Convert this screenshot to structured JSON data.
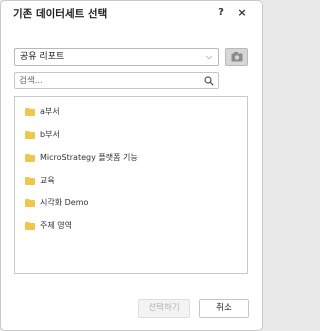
{
  "dialog": {
    "title": "기존 데이터세트 선택",
    "help_label": "?",
    "close_label": "×"
  },
  "source": {
    "selected": "공유 리포트",
    "chevron": "⌵"
  },
  "search": {
    "placeholder": "검색..."
  },
  "folders": [
    {
      "label": "a부서",
      "icon": "folder-icon"
    },
    {
      "label": "b부서",
      "icon": "folder-icon"
    },
    {
      "label": "MicroStrategy 플랫폼 기능",
      "icon": "folder-icon"
    },
    {
      "label": "교육",
      "icon": "folder-icon"
    },
    {
      "label": "시각화 Demo",
      "icon": "folder-icon"
    },
    {
      "label": "주제 영역",
      "icon": "folder-icon"
    }
  ],
  "footer": {
    "select_label": "선택하기",
    "cancel_label": "취소"
  },
  "colors": {
    "folder": "#f0c64c",
    "border": "#c9c9c9",
    "disabled_text": "#b4b4b4"
  }
}
